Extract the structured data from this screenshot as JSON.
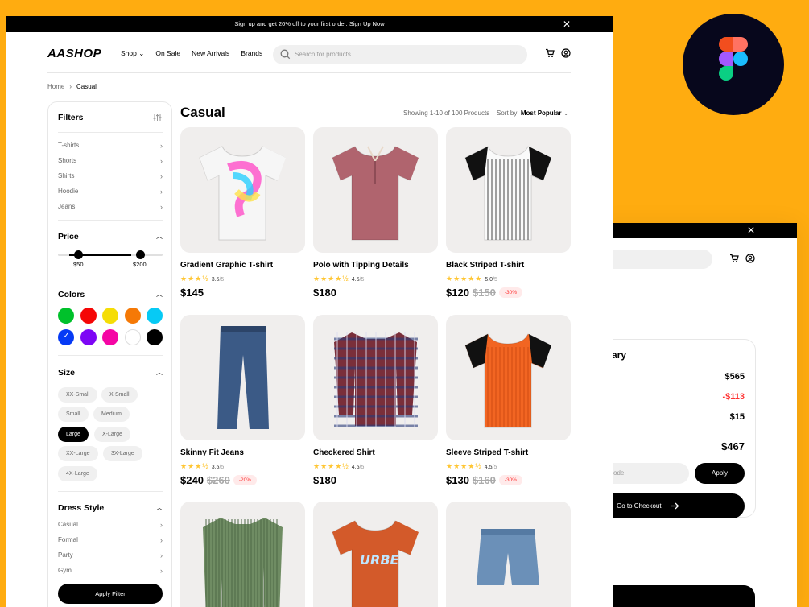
{
  "promo_bar": {
    "text": "Sign up and get 20% off to your first order.",
    "link": "Sign Up Now",
    "close": "✕"
  },
  "nav": {
    "logo": "AASHOP",
    "links": [
      {
        "label": "Shop",
        "chevron": "⌄"
      },
      {
        "label": "On Sale"
      },
      {
        "label": "New Arrivals"
      },
      {
        "label": "Brands"
      }
    ],
    "search_placeholder": "Search for products..."
  },
  "breadcrumb": {
    "home": "Home",
    "separator": "›",
    "current": "Casual"
  },
  "filters": {
    "title": "Filters",
    "categories": [
      "T-shirts",
      "Shorts",
      "Shirts",
      "Hoodie",
      "Jeans"
    ],
    "price": {
      "title": "Price",
      "min_label": "$50",
      "max_label": "$200"
    },
    "colors": {
      "title": "Colors",
      "swatches": [
        "#00C12B",
        "#F50606",
        "#F5DD06",
        "#F57906",
        "#06CAF5",
        "#063AF5",
        "#7D06F5",
        "#F506A4",
        "#FFFFFF",
        "#000000"
      ],
      "selected": "#063AF5",
      "check": "✓"
    },
    "size": {
      "title": "Size",
      "options": [
        "XX-Small",
        "X-Small",
        "Small",
        "Medium",
        "Large",
        "X-Large",
        "XX-Large",
        "3X-Large",
        "4X-Large"
      ],
      "selected": "Large"
    },
    "dress_style": {
      "title": "Dress Style",
      "options": [
        "Casual",
        "Formal",
        "Party",
        "Gym"
      ]
    },
    "apply_label": "Apply Filter"
  },
  "listing": {
    "title": "Casual",
    "showing": "Showing 1-10 of 100 Products",
    "sort_prefix": "Sort by:",
    "sort_value": "Most Popular",
    "products": [
      {
        "name": "Gradient Graphic T-shirt",
        "stars": "★★★½",
        "rating": "3.5",
        "den": "/5",
        "price": "$145",
        "old": "",
        "discount": "",
        "art": "tee-gradient"
      },
      {
        "name": "Polo with Tipping Details",
        "stars": "★★★★½",
        "rating": "4.5",
        "den": "/5",
        "price": "$180",
        "old": "",
        "discount": "",
        "art": "polo"
      },
      {
        "name": "Black Striped T-shirt",
        "stars": "★★★★★",
        "rating": "5.0",
        "den": "/5",
        "price": "$120",
        "old": "$150",
        "discount": "-30%",
        "art": "raglan-black"
      },
      {
        "name": "Skinny Fit Jeans",
        "stars": "★★★½",
        "rating": "3.5",
        "den": "/5",
        "price": "$240",
        "old": "$260",
        "discount": "-20%",
        "art": "jeans"
      },
      {
        "name": "Checkered Shirt",
        "stars": "★★★★½",
        "rating": "4.5",
        "den": "/5",
        "price": "$180",
        "old": "",
        "discount": "",
        "art": "checkered"
      },
      {
        "name": "Sleeve Striped T-shirt",
        "stars": "★★★★½",
        "rating": "4.5",
        "den": "/5",
        "price": "$130",
        "old": "$160",
        "discount": "-30%",
        "art": "raglan-orange"
      },
      {
        "art": "green-shirt"
      },
      {
        "art": "orange-tee"
      },
      {
        "art": "shorts"
      }
    ]
  },
  "cart_window": {
    "close": "✕",
    "summary_title": "ary",
    "subtotal": "$565",
    "discount": "-$113",
    "delivery": "$15",
    "total": "$467",
    "promo_placeholder": "ode",
    "apply_label": "Apply",
    "checkout_label": "Go to Checkout"
  }
}
